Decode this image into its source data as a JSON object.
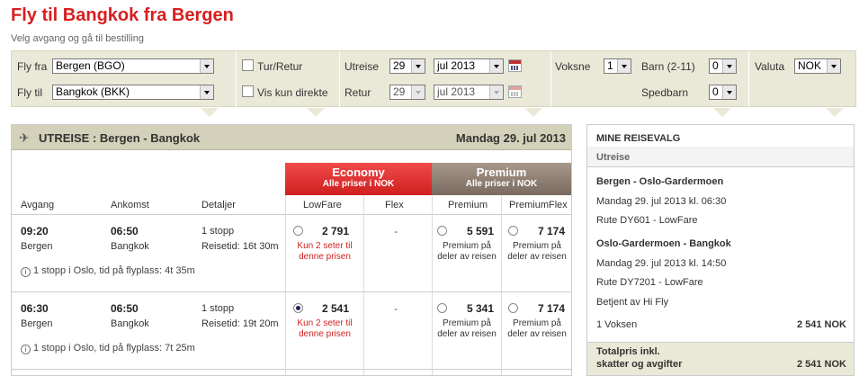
{
  "page": {
    "title": "Fly til Bangkok fra Bergen",
    "subtitle": "Velg avgang og gå til bestilling"
  },
  "search": {
    "from_label": "Fly fra",
    "from_value": "Bergen (BGO)",
    "to_label": "Fly til",
    "to_value": "Bangkok (BKK)",
    "roundtrip_label": "Tur/Retur",
    "direct_label": "Vis kun direkte",
    "departure_label": "Utreise",
    "departure_day": "29",
    "departure_month": "jul 2013",
    "return_label": "Retur",
    "return_day": "29",
    "return_month": "jul 2013",
    "adults_label": "Voksne",
    "adults_value": "1",
    "children_label": "Barn (2-11)",
    "children_value": "0",
    "infants_label": "Spedbarn",
    "infants_value": "0",
    "currency_label": "Valuta",
    "currency_value": "NOK"
  },
  "outbound": {
    "heading": "UTREISE :  Bergen - Bangkok",
    "date": "Mandag 29. jul 2013",
    "economy_title": "Economy",
    "economy_sub": "Alle priser i NOK",
    "premium_title": "Premium",
    "premium_sub": "Alle priser i NOK",
    "columns": {
      "departure": "Avgang",
      "arrival": "Ankomst",
      "details": "Detaljer",
      "lowfare": "LowFare",
      "flex": "Flex",
      "premium": "Premium",
      "premiumflex": "PremiumFlex"
    },
    "flights": [
      {
        "dep_time": "09:20",
        "dep_city": "Bergen",
        "arr_time": "06:50",
        "arr_city": "Bangkok",
        "stops": "1 stopp",
        "travel_time": "Reisetid: 16t 30m",
        "info": "1 stopp i Oslo, tid på flyplass: 4t 35m",
        "lowfare_price": "2 791",
        "lowfare_selected": false,
        "lowfare_note": "Kun 2 seter til denne prisen",
        "flex": "-",
        "premium_price": "5 591",
        "premium_note": "Premium på deler av reisen",
        "premiumflex_price": "7 174",
        "premiumflex_note": "Premium på deler av reisen"
      },
      {
        "dep_time": "06:30",
        "dep_city": "Bergen",
        "arr_time": "06:50",
        "arr_city": "Bangkok",
        "stops": "1 stopp",
        "travel_time": "Reisetid: 19t 20m",
        "info": "1 stopp i Oslo, tid på flyplass: 7t 25m",
        "lowfare_price": "2 541",
        "lowfare_selected": true,
        "lowfare_note": "Kun 2 seter til denne prisen",
        "flex": "-",
        "premium_price": "5 341",
        "premium_note": "Premium på deler av reisen",
        "premiumflex_price": "7 174",
        "premiumflex_note": "Premium på deler av reisen"
      }
    ]
  },
  "sidebar": {
    "heading": "MINE REISEVALG",
    "section": "Utreise",
    "leg1_route": "Bergen - Oslo-Gardermoen",
    "leg1_date": "Mandag 29. jul 2013 kl. 06:30",
    "leg1_flight": "Rute DY601 - LowFare",
    "leg2_route": "Oslo-Gardermoen - Bangkok",
    "leg2_date": "Mandag 29. jul 2013 kl. 14:50",
    "leg2_flight": "Rute DY7201 - LowFare",
    "leg2_operator": "Betjent av Hi Fly",
    "pax_label": "1 Voksen",
    "pax_price": "2 541 NOK",
    "total_label_1": "Totalpris inkl.",
    "total_label_2": "skatter og avgifter",
    "total_price": "2 541 NOK"
  },
  "colors": {
    "accent_red": "#d81e1e",
    "panel_beige": "#eae9d8",
    "header_beige": "#d3d1b9",
    "premium_brown": "#7a6a5f"
  }
}
